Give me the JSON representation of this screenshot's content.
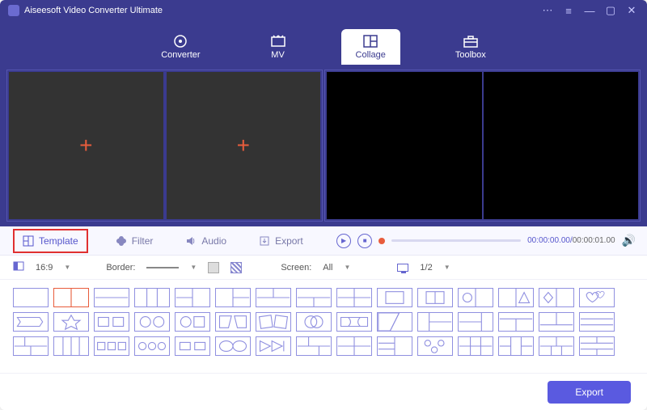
{
  "app": {
    "title": "Aiseesoft Video Converter Ultimate"
  },
  "nav": {
    "items": [
      {
        "label": "Converter"
      },
      {
        "label": "MV"
      },
      {
        "label": "Collage"
      },
      {
        "label": "Toolbox"
      }
    ]
  },
  "tabs": {
    "template": "Template",
    "filter": "Filter",
    "audio": "Audio",
    "export": "Export"
  },
  "playback": {
    "current": "00:00:00.00",
    "duration": "00:00:01.00"
  },
  "options": {
    "ratio": "16:9",
    "border_label": "Border:",
    "screen_label": "Screen:",
    "screen_value": "All",
    "pager": "1/2"
  },
  "footer": {
    "export": "Export"
  }
}
